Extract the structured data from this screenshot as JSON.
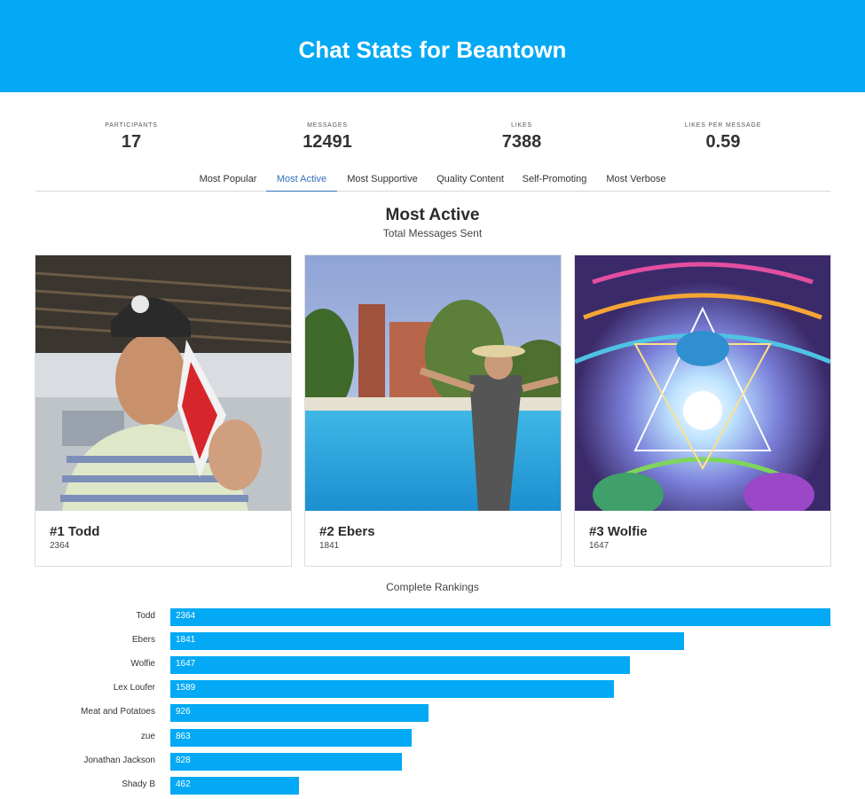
{
  "header": {
    "title": "Chat Stats for Beantown"
  },
  "stats": [
    {
      "label": "Participants",
      "value": "17"
    },
    {
      "label": "Messages",
      "value": "12491"
    },
    {
      "label": "Likes",
      "value": "7388"
    },
    {
      "label": "Likes per message",
      "value": "0.59"
    }
  ],
  "tabs": [
    {
      "label": "Most Popular",
      "active": false
    },
    {
      "label": "Most Active",
      "active": true
    },
    {
      "label": "Most Supportive",
      "active": false
    },
    {
      "label": "Quality Content",
      "active": false
    },
    {
      "label": "Self-Promoting",
      "active": false
    },
    {
      "label": "Most Verbose",
      "active": false
    }
  ],
  "section": {
    "title": "Most Active",
    "subtitle": "Total Messages Sent"
  },
  "top3": [
    {
      "rank_name": "#1 Todd",
      "count": "2364"
    },
    {
      "rank_name": "#2 Ebers",
      "count": "1841"
    },
    {
      "rank_name": "#3 Wolfie",
      "count": "1647"
    }
  ],
  "rankings": {
    "title": "Complete Rankings",
    "max": 2364,
    "items": [
      {
        "name": "Todd",
        "value": 2364
      },
      {
        "name": "Ebers",
        "value": 1841
      },
      {
        "name": "Wolfie",
        "value": 1647
      },
      {
        "name": "Lex Loufer",
        "value": 1589
      },
      {
        "name": "Meat and Potatoes",
        "value": 926
      },
      {
        "name": "zue",
        "value": 863
      },
      {
        "name": "Jonathan Jackson",
        "value": 828
      },
      {
        "name": "Shady B",
        "value": 462
      }
    ]
  },
  "colors": {
    "accent": "#03a9f4",
    "active_tab": "#2f6fc0"
  }
}
